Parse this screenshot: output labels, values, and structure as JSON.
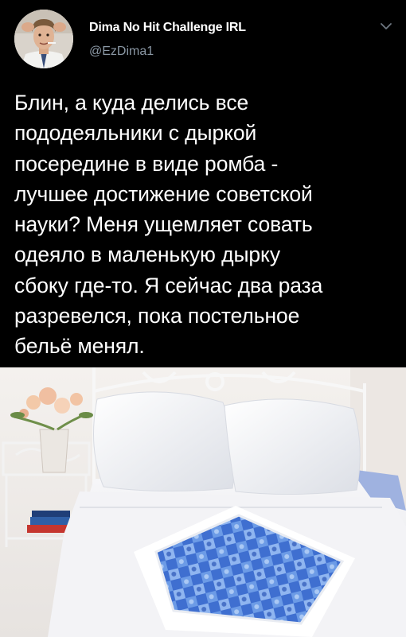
{
  "tweet": {
    "author": {
      "display_name": "Dima No Hit Challenge IRL",
      "handle": "@EzDima1"
    },
    "text": "Блин, а куда делись все\nпододеяльники с дыркой\nпосередине в виде ромба -\nлучшее достижение советской\nнауки? Меня ущемляет совать\nодеяло в маленькую дырку\nсбоку где-то. Я сейчас два раза\nразревелся, пока постельное\nбельё менял.",
    "menu_icon": "chevron-down-icon"
  },
  "colors": {
    "background": "#000000",
    "text": "#ffffff",
    "secondary_text": "#8b98a5"
  }
}
